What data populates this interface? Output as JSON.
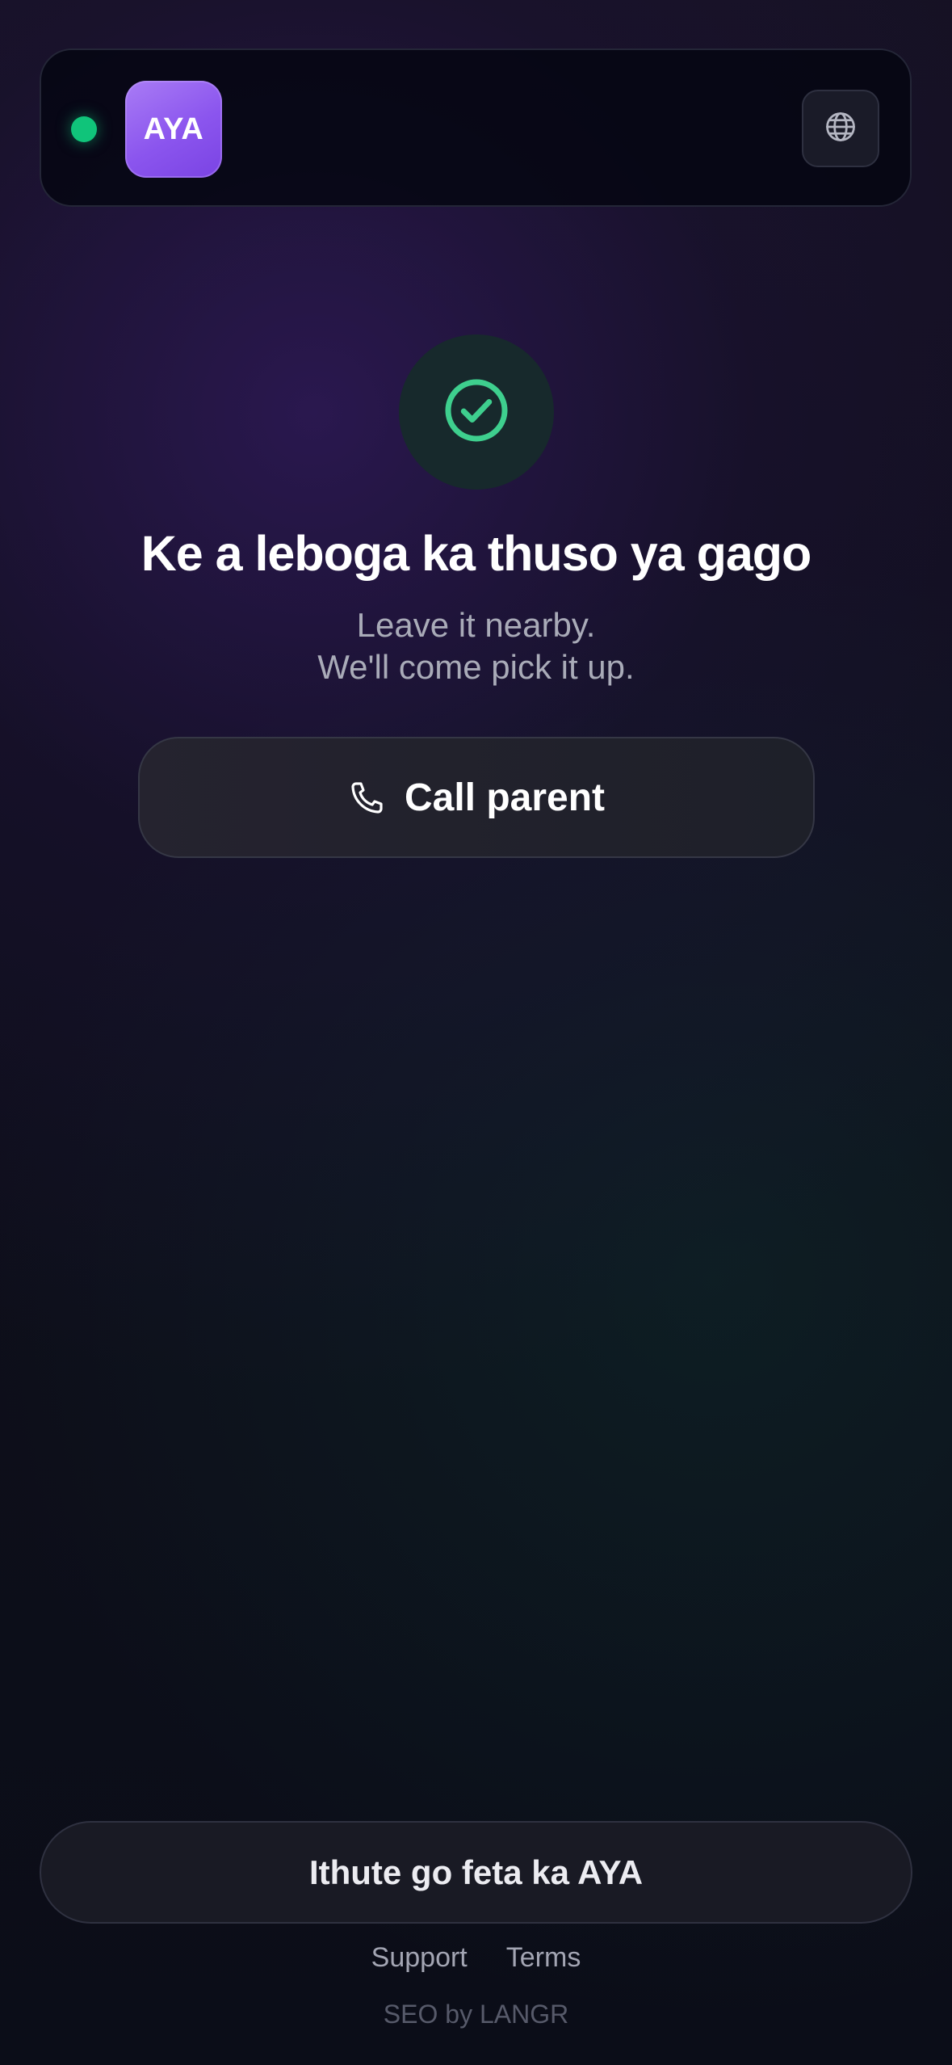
{
  "header": {
    "logo_text": "AYA",
    "status_color": "#10c47a",
    "language_icon": "globe-icon"
  },
  "main": {
    "success_icon": "check-circle-icon",
    "title": "Ke a leboga ka thuso ya gago",
    "subtitle_line1": "Leave it nearby.",
    "subtitle_line2": "We'll come pick it up.",
    "call_button": {
      "icon": "phone-icon",
      "label": "Call parent"
    }
  },
  "footer": {
    "learn_button_label": "Ithute go feta ka AYA",
    "links": [
      "Support",
      "Terms"
    ],
    "credit": "SEO by LANGR"
  },
  "colors": {
    "accent_green": "#3ecf8e",
    "brand_purple": "#8b55ee",
    "background": "#0b0c16"
  }
}
